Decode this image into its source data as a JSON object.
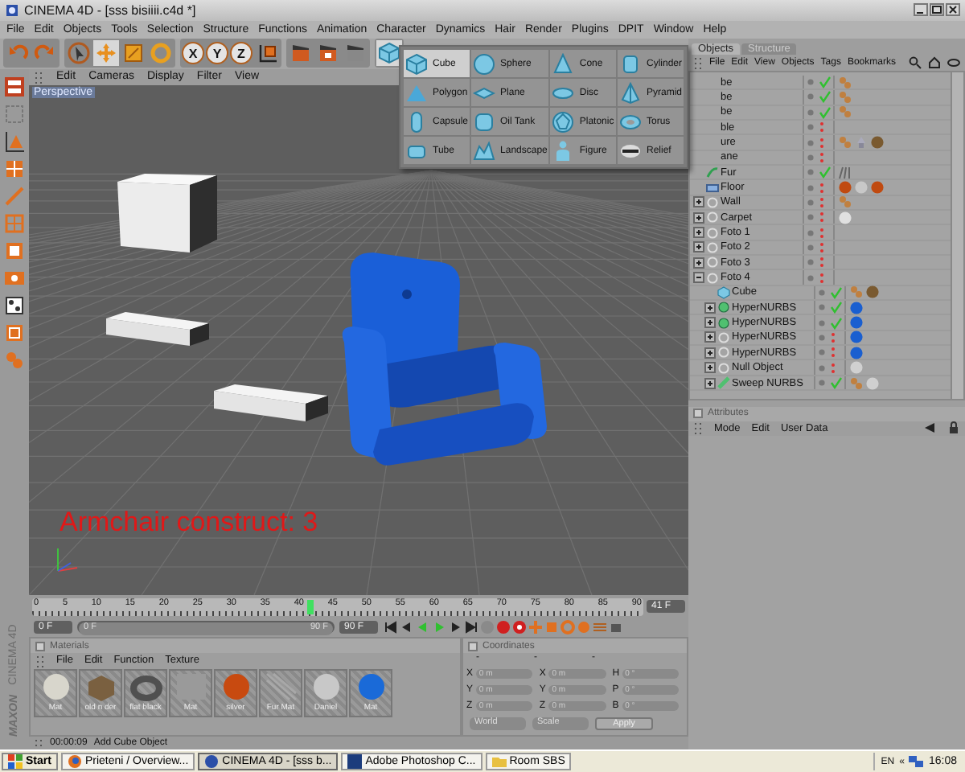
{
  "window": {
    "title": "CINEMA 4D - [sss bisiiii.c4d *]"
  },
  "menu": [
    "File",
    "Edit",
    "Objects",
    "Tools",
    "Selection",
    "Structure",
    "Functions",
    "Animation",
    "Character",
    "Dynamics",
    "Hair",
    "Render",
    "Plugins",
    "DPIT",
    "Window",
    "Help"
  ],
  "toolbar": {
    "mode_tools": [
      {
        "selected": false
      },
      {
        "selected": true
      },
      {
        "selected": false
      },
      {
        "selected": false
      }
    ],
    "axis_buttons": [
      {
        "label": "X",
        "on": true
      },
      {
        "label": "Y",
        "on": true
      },
      {
        "label": "Z",
        "on": true
      }
    ]
  },
  "primitives_menu": {
    "items": [
      {
        "label": "Cube",
        "selected": true
      },
      {
        "label": "Sphere",
        "selected": false
      },
      {
        "label": "Cone",
        "selected": false
      },
      {
        "label": "Cylinder",
        "selected": false
      },
      {
        "label": "Polygon",
        "selected": false
      },
      {
        "label": "Plane",
        "selected": false
      },
      {
        "label": "Disc",
        "selected": false
      },
      {
        "label": "Pyramid",
        "selected": false
      },
      {
        "label": "Capsule",
        "selected": false
      },
      {
        "label": "Oil Tank",
        "selected": false
      },
      {
        "label": "Platonic",
        "selected": false
      },
      {
        "label": "Torus",
        "selected": false
      },
      {
        "label": "Tube",
        "selected": false
      },
      {
        "label": "Landscape",
        "selected": false
      },
      {
        "label": "Figure",
        "selected": false
      },
      {
        "label": "Relief",
        "selected": false
      }
    ]
  },
  "viewport": {
    "menu": [
      "Edit",
      "Cameras",
      "Display",
      "Filter",
      "View"
    ],
    "camera_label": "Perspective",
    "overlay_text": "Armchair construct: 3"
  },
  "timeline": {
    "ticks": [
      "0",
      "5",
      "10",
      "15",
      "20",
      "25",
      "30",
      "35",
      "40",
      "45",
      "50",
      "55",
      "60",
      "65",
      "70",
      "75",
      "80",
      "85",
      "90"
    ],
    "level": 0.456,
    "frame_field": "41 F"
  },
  "transport": {
    "start_field": "0 F",
    "level": 1,
    "range_start": "0 F",
    "range_end": "90 F",
    "end_field": "90 F"
  },
  "materials": {
    "title": "Materials",
    "menu": [
      "File",
      "Edit",
      "Function",
      "Texture"
    ],
    "items": [
      {
        "name": "Mat",
        "kind": "sphere",
        "color": "#d8d6cc"
      },
      {
        "name": "old n der",
        "kind": "cube",
        "color": "#7a6040"
      },
      {
        "name": "flat black",
        "kind": "torus",
        "color": "#505050"
      },
      {
        "name": "Mat",
        "kind": "blank",
        "color": "#9a9a9a"
      },
      {
        "name": "silver",
        "kind": "sphere",
        "color": "#c84a10"
      },
      {
        "name": "Fur Mat",
        "kind": "hatch",
        "color": "#a8a8a8"
      },
      {
        "name": "Daniel",
        "kind": "sphere",
        "color": "#c8c8c8"
      },
      {
        "name": "Mat",
        "kind": "sphere",
        "color": "#1a6ad8"
      }
    ]
  },
  "coordinates": {
    "title": "Coordinates",
    "column_heads": [
      "-",
      "-",
      "-"
    ],
    "rows": [
      {
        "position_axis": "X",
        "position": "0 m",
        "size_axis": "X",
        "size": "0 m",
        "rotation_axis": "H",
        "rotation": "0 °"
      },
      {
        "position_axis": "Y",
        "position": "0 m",
        "size_axis": "Y",
        "size": "0 m",
        "rotation_axis": "P",
        "rotation": "0 °"
      },
      {
        "position_axis": "Z",
        "position": "0 m",
        "size_axis": "Z",
        "size": "0 m",
        "rotation_axis": "B",
        "rotation": "0 °"
      }
    ],
    "dropdowns": [
      "World",
      "Scale"
    ],
    "apply_button": "Apply"
  },
  "status_bar": {
    "time": "00:00:09",
    "message": "Add Cube Object"
  },
  "side_logo": {
    "brand": "MAXON",
    "product": "CINEMA 4D"
  },
  "object_manager": {
    "tabs": [
      {
        "label": "Objects",
        "selected": true
      },
      {
        "label": "Structure",
        "selected": false
      }
    ],
    "menu": [
      "File",
      "Edit",
      "View",
      "Objects",
      "Tags",
      "Bookmarks"
    ],
    "objects": [
      {
        "name": "be",
        "kind": "hidden",
        "enabled": true,
        "tags": [
          {
            "kind": "texture"
          }
        ]
      },
      {
        "name": "be",
        "kind": "hidden",
        "enabled": true,
        "tags": [
          {
            "kind": "texture"
          }
        ]
      },
      {
        "name": "be",
        "kind": "hidden",
        "enabled": true,
        "tags": [
          {
            "kind": "texture"
          }
        ]
      },
      {
        "name": "ble",
        "kind": "hidden",
        "enabled": false
      },
      {
        "name": "ure",
        "kind": "hidden",
        "enabled": false,
        "tags": [
          {
            "kind": "texture"
          },
          {
            "kind": "constraint"
          },
          {
            "kind": "material",
            "color": "#7a5a30"
          }
        ]
      },
      {
        "name": "ane",
        "kind": "hidden",
        "enabled": false
      },
      {
        "name": "Fur",
        "kind": "hair",
        "enabled": true,
        "tags": [
          {
            "kind": "hair"
          }
        ]
      },
      {
        "name": "Floor",
        "kind": "floor",
        "enabled": false,
        "tags": [
          {
            "kind": "material",
            "color": "#c04a10"
          },
          {
            "kind": "material",
            "color": "#c8c8c8"
          },
          {
            "kind": "material",
            "color": "#c04a10"
          }
        ]
      },
      {
        "name": "Wall",
        "kind": "null",
        "enabled": false,
        "expanded": false,
        "tags": [
          {
            "kind": "texture"
          }
        ]
      },
      {
        "name": "Carpet",
        "kind": "null",
        "enabled": false,
        "expanded": false,
        "tags": [
          {
            "kind": "material",
            "color": "#e0e0e0"
          }
        ]
      },
      {
        "name": "Foto 1",
        "kind": "null",
        "enabled": false,
        "expanded": false
      },
      {
        "name": "Foto 2",
        "kind": "null",
        "enabled": false,
        "expanded": false
      },
      {
        "name": "Foto 3",
        "kind": "null",
        "enabled": false,
        "expanded": false
      },
      {
        "name": "Foto 4",
        "kind": "null",
        "enabled": false,
        "expanded": true,
        "children": [
          {
            "name": "Cube",
            "kind": "cube",
            "enabled": true,
            "tags": [
              {
                "kind": "texture"
              },
              {
                "kind": "material",
                "color": "#7a5a30"
              }
            ]
          },
          {
            "name": "HyperNURBS",
            "kind": "nurbs",
            "enabled": true,
            "expanded": false,
            "tags": [
              {
                "kind": "material",
                "color": "#1a5fd0"
              }
            ]
          },
          {
            "name": "HyperNURBS",
            "kind": "nurbs",
            "enabled": true,
            "expanded": false,
            "tags": [
              {
                "kind": "material",
                "color": "#1a5fd0"
              }
            ]
          },
          {
            "name": "HyperNURBS",
            "kind": "null",
            "enabled": false,
            "expanded": false,
            "tags": [
              {
                "kind": "material",
                "color": "#1a5fd0"
              }
            ]
          },
          {
            "name": "HyperNURBS",
            "kind": "null",
            "enabled": false,
            "expanded": false,
            "tags": [
              {
                "kind": "material",
                "color": "#1a5fd0"
              }
            ]
          },
          {
            "name": "Null Object",
            "kind": "null",
            "enabled": false,
            "expanded": false,
            "tags": [
              {
                "kind": "material",
                "color": "#d0d0d0"
              }
            ]
          },
          {
            "name": "Sweep NURBS",
            "kind": "sweep",
            "enabled": true,
            "expanded": false,
            "tags": [
              {
                "kind": "texture"
              },
              {
                "kind": "material",
                "color": "#d0d0d0"
              }
            ]
          }
        ]
      }
    ]
  },
  "attributes": {
    "title": "Attributes",
    "menu": [
      "Mode",
      "Edit",
      "User Data"
    ]
  },
  "taskbar": {
    "start": "Start",
    "tasks": [
      {
        "label": "Prieteni / Overview...",
        "selected": false
      },
      {
        "label": "CINEMA 4D - [sss b...",
        "selected": true
      },
      {
        "label": "Adobe Photoshop C...",
        "selected": false
      },
      {
        "label": "Room SBS",
        "selected": false
      }
    ],
    "tray": [
      "EN",
      "«"
    ],
    "clock": "16:08"
  }
}
